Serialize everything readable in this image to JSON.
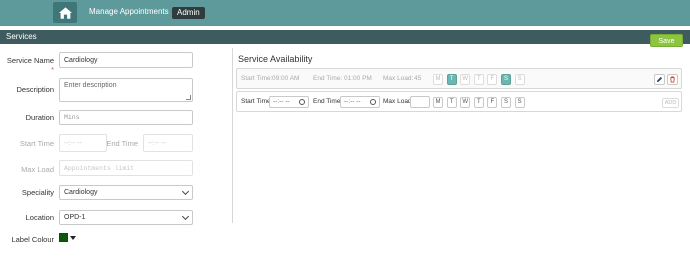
{
  "nav": {
    "home_icon": "home-icon",
    "link": "Manage Appointments",
    "badge": "Admin"
  },
  "section": {
    "title": "Services",
    "save_label": "Save"
  },
  "form": {
    "service_name": {
      "label": "Service Name",
      "required_mark": "*",
      "value": "Cardiology"
    },
    "description": {
      "label": "Description",
      "placeholder": "Enter description"
    },
    "duration": {
      "label": "Duration",
      "placeholder": "Mins"
    },
    "start_time": {
      "label": "Start Time",
      "placeholder": "--:-- --"
    },
    "end_time": {
      "label": "End Time",
      "placeholder": "--:-- --"
    },
    "max_load": {
      "label": "Max Load",
      "placeholder": "Appointments limit"
    },
    "speciality": {
      "label": "Speciality",
      "value": "Cardiology"
    },
    "location": {
      "label": "Location",
      "value": "OPD-1"
    },
    "label_colour": {
      "label": "Label Colour",
      "value": "#0b5a0b"
    }
  },
  "availability": {
    "title": "Service Availability",
    "saved_row": {
      "start_label": "Start Time:",
      "start_value": "09:00 AM",
      "end_label": "End Time:",
      "end_value": "01:00 PM",
      "max_label": "Max Load:",
      "max_value": "45",
      "days": [
        {
          "letter": "M",
          "on": false
        },
        {
          "letter": "T",
          "on": true
        },
        {
          "letter": "W",
          "on": false
        },
        {
          "letter": "T",
          "on": false
        },
        {
          "letter": "F",
          "on": false
        },
        {
          "letter": "S",
          "on": true
        },
        {
          "letter": "S",
          "on": false
        }
      ],
      "edit_icon": "pencil-icon",
      "delete_icon": "trash-icon"
    },
    "new_row": {
      "start_label": "Start Time",
      "start_placeholder": "--:-- --",
      "end_label": "End Time",
      "end_placeholder": "--:-- --",
      "max_label": "Max Load",
      "days": [
        "M",
        "T",
        "W",
        "T",
        "F",
        "S",
        "S"
      ],
      "add_label": "ADD"
    }
  },
  "colors": {
    "topbar": "#5e9a9b",
    "section_header": "#3e5c60",
    "save_button": "#8cc63f",
    "day_selected": "#6cb5b0"
  }
}
